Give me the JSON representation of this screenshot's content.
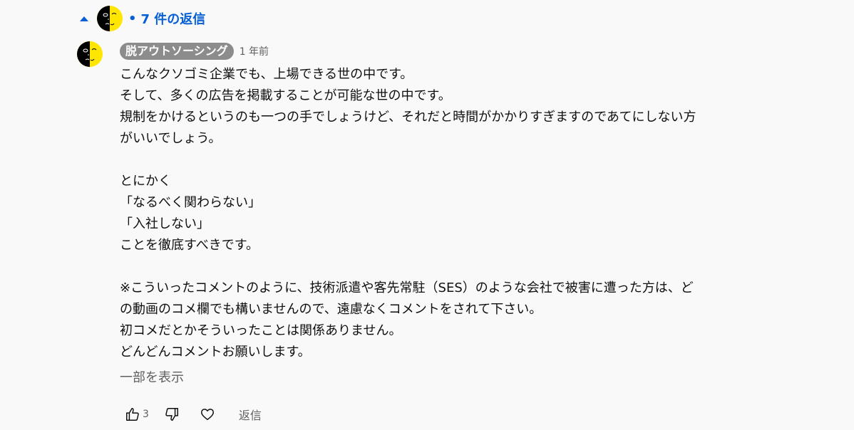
{
  "replies": {
    "toggle_count_label": "7 件の返信",
    "separator": "•"
  },
  "comment": {
    "author": "脱アウトソーシング",
    "timestamp": "1 年前",
    "lines": [
      "こんなクソゴミ企業でも、上場できる世の中です。",
      "そして、多くの広告を掲載することが可能な世の中です。",
      "規制をかけるというのも一つの手でしょうけど、それだと時間がかかりすぎますのであてにしない方",
      "がいいでしょう。",
      "",
      "とにかく",
      "「なるべく関わらない」",
      "「入社しない」",
      "ことを徹底すべきです。",
      "",
      "※こういったコメントのように、技術派遣や客先常駐（SES）のような会社で被害に遭った方は、ど",
      "の動画のコメ欄でも構いませんので、遠慮なくコメントをされて下さい。",
      "初コメだとかそういったことは関係ありません。",
      "どんどんコメントお願いします。"
    ],
    "show_more": "一部を表示",
    "like_count": "3",
    "reply_label": "返信"
  },
  "colors": {
    "link": "#065fd4",
    "badge_bg": "#8c8c8c",
    "avatar_left": "#000000",
    "avatar_right": "#ffe600"
  },
  "icons": [
    "caret-up-icon",
    "avatar-moon-icon",
    "thumbs-up-icon",
    "thumbs-down-icon",
    "heart-icon"
  ]
}
